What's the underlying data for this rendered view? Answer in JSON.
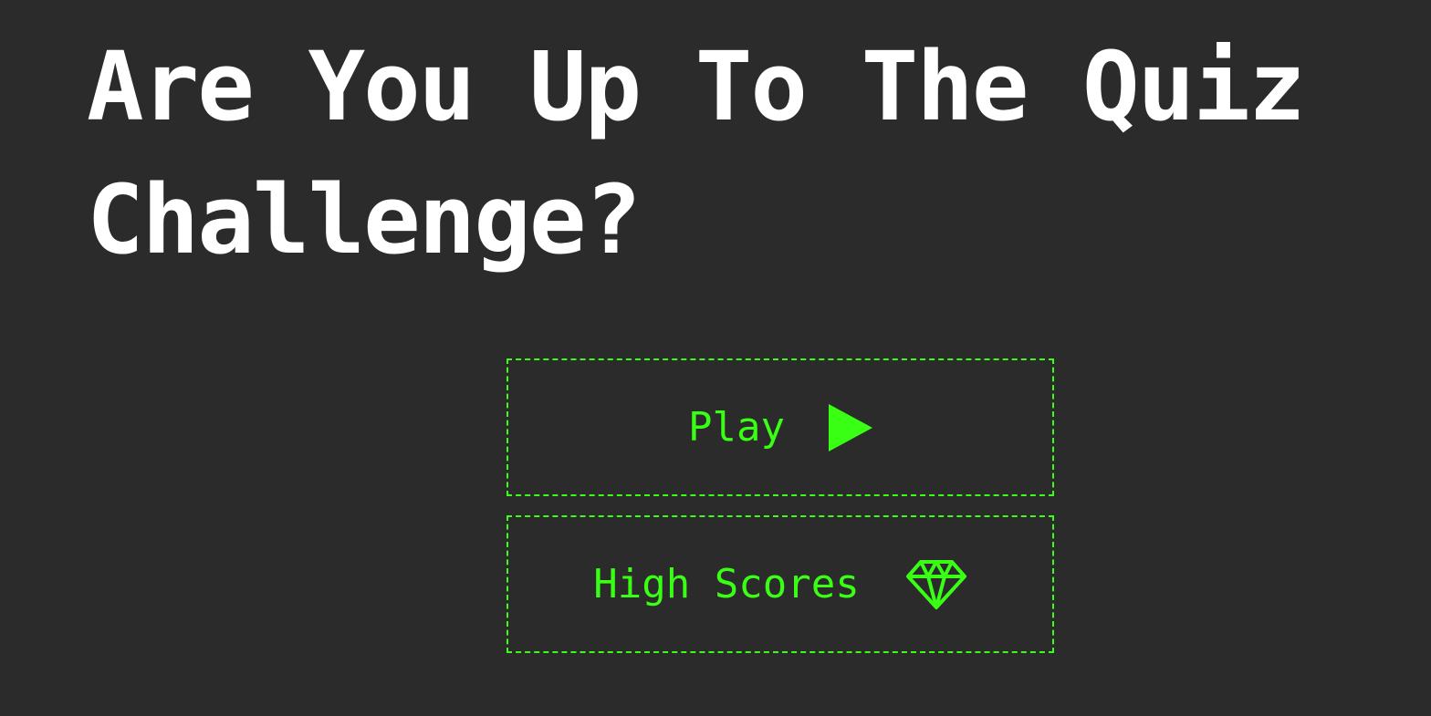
{
  "page": {
    "title": "Are You Up To The Quiz Challenge?"
  },
  "menu": {
    "play_label": "Play",
    "play_icon": "play-icon",
    "high_scores_label": "High Scores",
    "high_scores_icon": "diamond-icon"
  },
  "colors": {
    "background": "#2b2b2b",
    "title": "#ffffff",
    "accent": "#39ff14"
  }
}
